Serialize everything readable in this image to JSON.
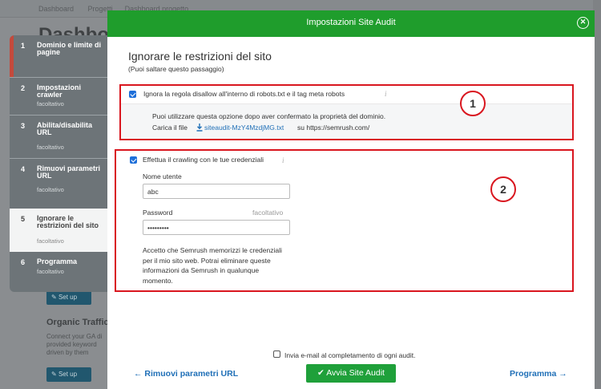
{
  "background": {
    "breadcrumb_1": "Dashboard",
    "breadcrumb_2": "Progetti",
    "breadcrumb_3": "Dashboard progetto",
    "page_title": "Dashboard",
    "card_title": "Organic Traffic",
    "card_text": "Connect your GA di provided keyword driven by them",
    "setup_label": "Set up"
  },
  "steps": [
    {
      "num": "1",
      "title": "Dominio e limite di pagine",
      "sub": ""
    },
    {
      "num": "2",
      "title": "Impostazioni crawler",
      "sub": "facoltativo"
    },
    {
      "num": "3",
      "title": "Abilita/disabilita URL",
      "sub": "facoltativo"
    },
    {
      "num": "4",
      "title": "Rimuovi parametri URL",
      "sub": "facoltativo"
    },
    {
      "num": "5",
      "title": "Ignorare le restrizioni del sito",
      "sub": "facoltativo"
    },
    {
      "num": "6",
      "title": "Programma",
      "sub": "facoltativo"
    }
  ],
  "modal": {
    "title": "Impostazioni Site Audit",
    "section_title": "Ignorare le restrizioni del sito",
    "section_sub": "(Puoi saltare questo passaggio)",
    "option1_label": "Ignora la regola disallow all'interno di robots.txt e il tag meta robots",
    "option1_help_1": "Puoi utilizzare questa opzione dopo aver confermato la proprietà del dominio.",
    "option1_help_2_prefix": "Carica il file",
    "option1_file": "siteaudit-MzY4MzdjMG.txt",
    "option1_help_2_suffix": "su https://semrush.com/",
    "option2_label": "Effettua il crawling con le tue credenziali",
    "username_label": "Nome utente",
    "username_value": "abc",
    "password_label": "Password",
    "password_optional": "facoltativo",
    "password_value": "•••••••••",
    "disclaimer": "Accetto che Semrush memorizzi le credenziali per il mio sito web. Potrai eliminare queste informazioni da Semrush in qualunque momento.",
    "callout_1": "1",
    "callout_2": "2",
    "email_checkbox_label": "Invia e-mail al completamento di ogni audit.",
    "prev_label": "Rimuovi parametri URL",
    "run_label": "Avvia Site Audit",
    "next_label": "Programma"
  },
  "colors": {
    "header_green": "#1f9d2c",
    "button_green": "#1fa03a",
    "link_blue": "#1f6fb7",
    "highlight_red": "#d9161f",
    "checkbox_blue": "#1e6fd9"
  },
  "icons": {
    "close": "close-circle-icon",
    "info": "info-icon",
    "download": "download-icon",
    "check": "check-icon",
    "arrow_left": "arrow-left-icon",
    "arrow_right": "arrow-right-icon"
  }
}
